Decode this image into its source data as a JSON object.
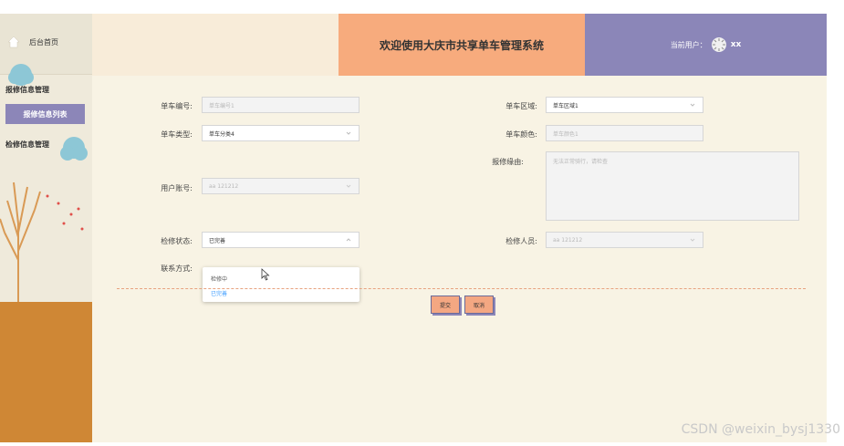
{
  "sidebar": {
    "home_label": "后台首页",
    "menus": [
      {
        "title": "报修信息管理",
        "sub": "报修信息列表"
      },
      {
        "title": "检修信息管理"
      }
    ]
  },
  "header": {
    "title": "欢迎使用大庆市共享单车管理系统",
    "user_prefix": "当前用户：",
    "user_name": "xx"
  },
  "form": {
    "bike_no": {
      "label": "单车编号:",
      "placeholder": "单车编号1"
    },
    "bike_area": {
      "label": "单车区域:",
      "value": "单车区域1"
    },
    "bike_type": {
      "label": "单车类型:",
      "value": "单车分类4"
    },
    "bike_color": {
      "label": "单车颜色:",
      "placeholder": "单车颜色1"
    },
    "repair_reason": {
      "label": "报修缘由:",
      "placeholder": "无法正常骑行，请检查"
    },
    "user_account": {
      "label": "用户账号:",
      "value": "aa 121212"
    },
    "repair_status": {
      "label": "检修状态:",
      "value": "已完善"
    },
    "repair_person": {
      "label": "检修人员:",
      "value": "aa 121212"
    },
    "contact": {
      "label": "联系方式:"
    },
    "status_options": [
      "检修中",
      "已完善"
    ],
    "selected_option_index": 1
  },
  "buttons": {
    "submit": "提交",
    "cancel": "取消"
  },
  "watermark": "CSDN @weixin_bysj1330",
  "colors": {
    "accent_purple": "#8b86b8",
    "accent_orange": "#f7ab7d",
    "bg": "#f8f3e4"
  }
}
